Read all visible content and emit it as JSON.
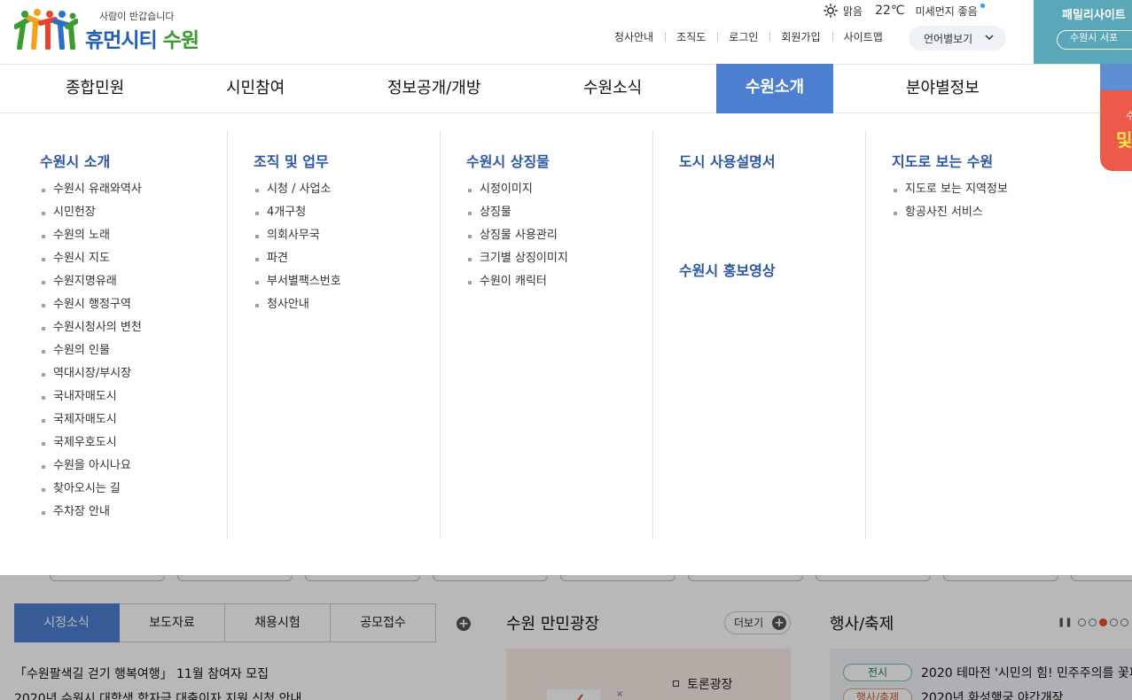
{
  "header": {
    "logo_tagline": "사람이 반갑습니다",
    "logo_name_1": "휴먼시티",
    "logo_name_2": "수원",
    "weather": {
      "condition": "맑음",
      "temperature": "22℃",
      "dust_label": "미세먼지",
      "dust_value": "좋음",
      "icon": "sun-icon"
    },
    "utility_links": [
      "청사안내",
      "조직도",
      "로그인",
      "회원가입",
      "사이트맵"
    ],
    "language_button": "언어별보기",
    "family_site": {
      "title": "패밀리사이트",
      "pill_text": "수원시 서포"
    }
  },
  "gnb": {
    "items": [
      "종합민원",
      "시민참여",
      "정보공개/개방",
      "수원소식",
      "수원소개",
      "분야별정보"
    ],
    "active": "수원소개"
  },
  "side_banner": {
    "text1": "수",
    "text2": "및"
  },
  "mega_menu": {
    "columns": [
      {
        "title": "수원시 소개",
        "items": [
          "수원시 유래와역사",
          "시민헌장",
          "수원의 노래",
          "수원시 지도",
          "수원지명유래",
          "수원시 행정구역",
          "수원시청사의 변천",
          "수원의 인물",
          "역대시장/부시장",
          "국내자매도시",
          "국제자매도시",
          "국제우호도시",
          "수원을 아시나요",
          "찾아오시는 길",
          "주차장 안내"
        ]
      },
      {
        "title": "조직 및 업무",
        "items": [
          "시청 / 사업소",
          "4개구청",
          "의회사무국",
          "파견",
          "부서별팩스번호",
          "청사안내"
        ]
      },
      {
        "title": "수원시 상징물",
        "items": [
          "시정이미지",
          "상징물",
          "상징물 사용관리",
          "크기별 상징이미지",
          "수원이 캐릭터"
        ]
      },
      {
        "title": "도시 사용설명서",
        "title2": "수원시 홍보영상",
        "items": []
      },
      {
        "title": "지도로 보는 수원",
        "items": [
          "지도로 보는 지역정보",
          "항공사진 서비스"
        ]
      }
    ]
  },
  "news": {
    "tabs": [
      "시정소식",
      "보도자료",
      "채용시험",
      "공모접수"
    ],
    "active_tab": "시정소식",
    "items": [
      "「수원팔색길 걷기 행복여행」 11월 참여자 모집",
      "2020년 수원시 대학생 학자금 대출이자 지원 신청 안내"
    ]
  },
  "plaza": {
    "title": "수원 만민광장",
    "more": "더보기",
    "link": "토론광장"
  },
  "events": {
    "title": "행사/축제",
    "items": [
      {
        "badge": "전시",
        "title": "2020 테마전 '시민의 힘! 민주주의를 꽃피"
      },
      {
        "badge": "행사/축제",
        "title": "2020년 화성행궁 야간개장"
      }
    ],
    "pager_active": 3
  },
  "colors": {
    "accent": "#4c7fd0",
    "menu_title": "#2c56a6",
    "logo_blue": "#1f5fb5",
    "logo_green": "#3b9b2f",
    "family_bg": "#5aa7b9",
    "side_red": "#ee5a4a"
  }
}
